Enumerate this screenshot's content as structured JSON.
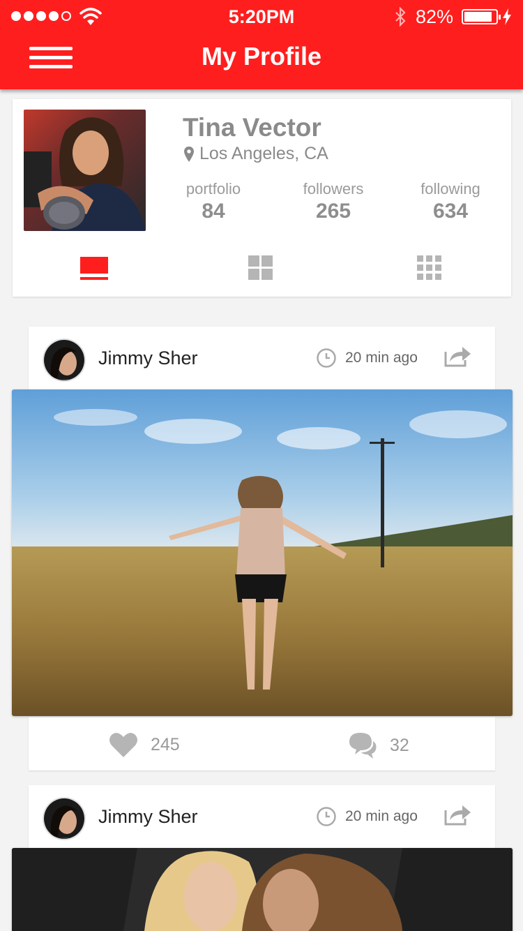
{
  "status_bar": {
    "time": "5:20PM",
    "battery_percent": "82%",
    "battery_level": 0.82,
    "signal_bars": 4
  },
  "header": {
    "title": "My Profile",
    "menu_icon": "hamburger-menu-icon"
  },
  "profile": {
    "name": "Tina Vector",
    "location": "Los Angeles, CA",
    "stats": [
      {
        "label": "portfolio",
        "value": "84"
      },
      {
        "label": "followers",
        "value": "265"
      },
      {
        "label": "following",
        "value": "634"
      }
    ],
    "view_modes": [
      "list-view-icon",
      "grid-view-icon",
      "small-grid-view-icon"
    ],
    "active_view": "list-view-icon"
  },
  "posts": [
    {
      "author": "Jimmy Sher",
      "time": "20 min ago",
      "likes": "245",
      "comments": "32"
    },
    {
      "author": "Jimmy Sher",
      "time": "20 min ago"
    }
  ],
  "colors": {
    "accent": "#ff1e1e",
    "muted": "#9a9a9a",
    "background": "#f3f3f3"
  }
}
